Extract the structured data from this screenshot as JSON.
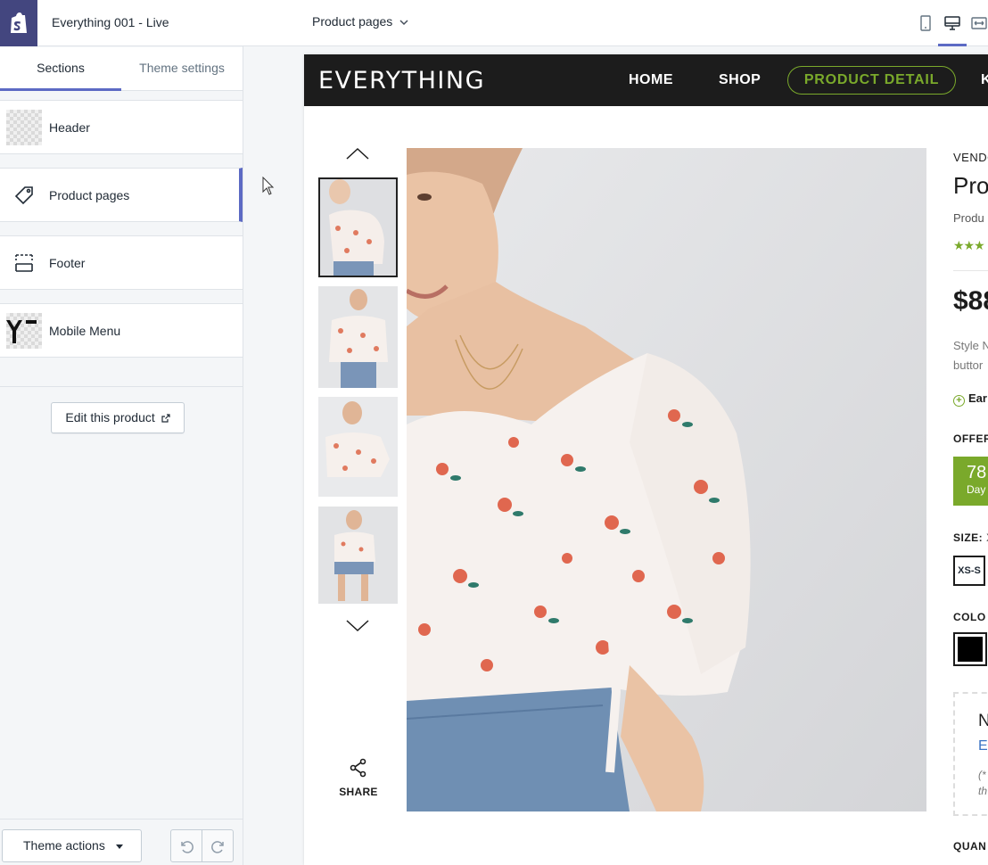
{
  "editor": {
    "theme_name": "Everything 001 - Live",
    "tabs": [
      "Sections",
      "Theme settings"
    ],
    "sections": [
      {
        "label": "Header"
      },
      {
        "label": "Product pages"
      },
      {
        "label": "Footer"
      },
      {
        "label": "Mobile Menu"
      }
    ],
    "edit_product_label": "Edit this product",
    "theme_actions_label": "Theme actions",
    "page_selector": "Product pages",
    "accent": "#5c6ac4",
    "icons": [
      "shopify-logo-icon",
      "tag-icon",
      "footer-icon",
      "mobile-menu-icon",
      "external-link-icon",
      "undo-icon",
      "redo-icon",
      "mobile-device-icon",
      "desktop-device-icon",
      "fullscreen-icon"
    ]
  },
  "store": {
    "brand": "EVERYTHING",
    "nav": [
      "HOME",
      "SHOP",
      "PRODUCT DETAIL",
      "K"
    ],
    "accent": "#7aa92b",
    "share_label": "SHARE",
    "vendor": "VENDO",
    "title": "Pro",
    "type": "Produ",
    "rating_stars": "★★★",
    "price": "$88",
    "desc_line1": "Style N",
    "desc_line2": "buttor",
    "earn": "Ear",
    "offer_label": "OFFER",
    "countdown_num": "78",
    "countdown_unit": "Day",
    "size_label": "SIZE:",
    "size_value": "X",
    "size_option": "XS-S",
    "color_label": "COLO",
    "notify_title": "N",
    "notify_link": "En",
    "notify_note1": "(*",
    "notify_note2": "th",
    "quantity_label": "QUAN"
  }
}
